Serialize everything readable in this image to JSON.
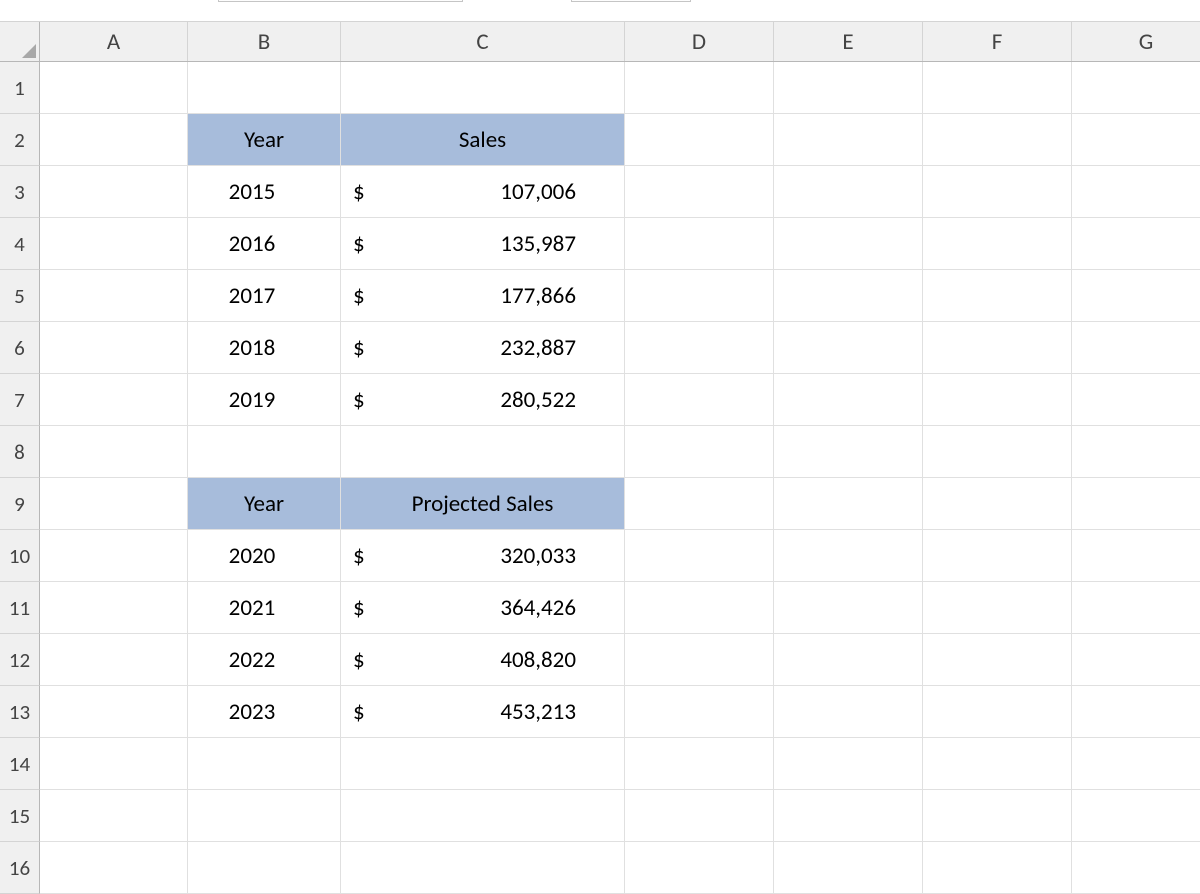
{
  "columns": [
    "A",
    "B",
    "C",
    "D",
    "E",
    "F",
    "G"
  ],
  "rowNumbers": [
    "1",
    "2",
    "3",
    "4",
    "5",
    "6",
    "7",
    "8",
    "9",
    "10",
    "11",
    "12",
    "13",
    "14",
    "15",
    "16"
  ],
  "currencySymbol": "$",
  "table1": {
    "headers": {
      "year": "Year",
      "sales": "Sales"
    },
    "rows": [
      {
        "year": "2015",
        "sales": "107,006"
      },
      {
        "year": "2016",
        "sales": "135,987"
      },
      {
        "year": "2017",
        "sales": "177,866"
      },
      {
        "year": "2018",
        "sales": "232,887"
      },
      {
        "year": "2019",
        "sales": "280,522"
      }
    ]
  },
  "table2": {
    "headers": {
      "year": "Year",
      "sales": "Projected Sales"
    },
    "rows": [
      {
        "year": "2020",
        "sales": "320,033"
      },
      {
        "year": "2021",
        "sales": "364,426"
      },
      {
        "year": "2022",
        "sales": "408,820"
      },
      {
        "year": "2023",
        "sales": "453,213"
      }
    ]
  }
}
